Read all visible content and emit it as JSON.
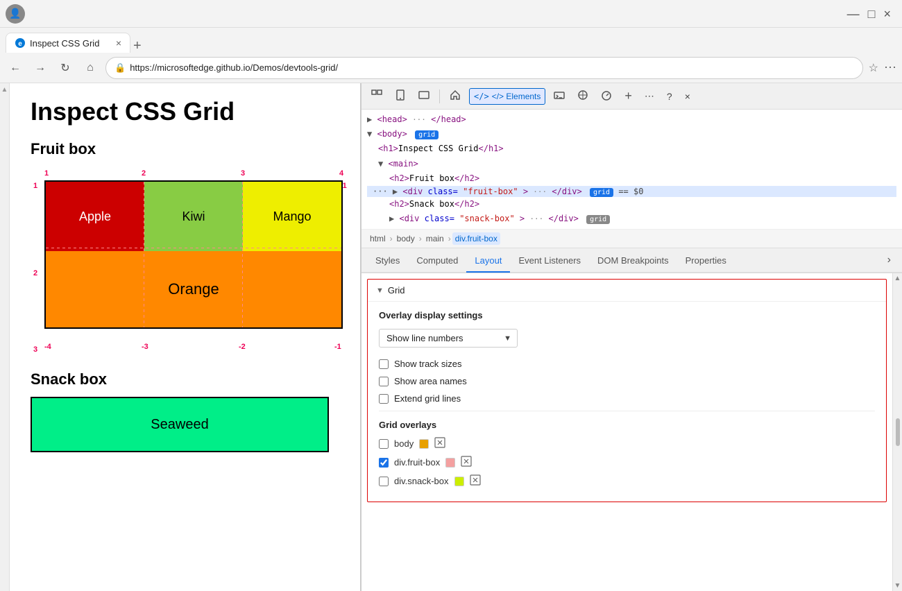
{
  "browser": {
    "title": "Inspect CSS Grid",
    "url": "https://microsoftedge.github.io/Demos/devtools-grid/",
    "tab_close": "×",
    "tab_new": "+",
    "win_min": "—",
    "win_max": "□",
    "win_close": "×"
  },
  "page": {
    "heading": "Inspect CSS Grid",
    "fruit_section": "Fruit box",
    "snack_section": "Snack box",
    "cells": {
      "apple": "Apple",
      "kiwi": "Kiwi",
      "mango": "Mango",
      "orange": "Orange",
      "seaweed": "Seaweed"
    },
    "col_labels": [
      "1",
      "2",
      "3",
      "4"
    ],
    "row_labels": [
      "1",
      "2",
      "3"
    ],
    "neg_col_labels": [
      "-4",
      "-3",
      "-2",
      "-1"
    ],
    "neg_row_label": "-1"
  },
  "devtools": {
    "toolbar": {
      "inspect": "⬚",
      "device": "⬚",
      "elements_label": "</> Elements",
      "console": "⬚",
      "sources": "⬚",
      "network": "⬚",
      "more": "⋯",
      "help": "?",
      "close": "×"
    },
    "dom": {
      "head_line": "▶ <head> ··· </head>",
      "body_open": "▼ <body>",
      "h1_line": "    <h1>Inspect CSS Grid</h1>",
      "main_open": "    ▼ <main>",
      "h2_fruit": "        <h2>Fruit box</h2>",
      "div_fruit": "    ··· ▶ <div class=\"fruit-box\"> ··· </div>",
      "h2_snack": "        <h2>Snack box</h2>",
      "div_snack": "    ▶ <div class=\"snack-box\"> ··· </div>",
      "grid_badge": "grid",
      "selected_marker": "== $0"
    },
    "breadcrumb": [
      "html",
      "body",
      "main",
      "div.fruit-box"
    ],
    "tabs": [
      "Styles",
      "Computed",
      "Layout",
      "Event Listeners",
      "DOM Breakpoints",
      "Properties"
    ],
    "active_tab": "Layout",
    "panel": {
      "grid_header": "Grid",
      "overlay_settings_title": "Overlay display settings",
      "dropdown_value": "Show line numbers",
      "checkbox1": "Show track sizes",
      "checkbox2": "Show area names",
      "checkbox3": "Extend grid lines",
      "grid_overlays_title": "Grid overlays",
      "overlays": [
        {
          "label": "body",
          "color": "#e8a000",
          "checked": false
        },
        {
          "label": "div.fruit-box",
          "color": "#f4a0a0",
          "checked": true
        },
        {
          "label": "div.snack-box",
          "color": "#ccee00",
          "checked": false
        }
      ]
    }
  }
}
